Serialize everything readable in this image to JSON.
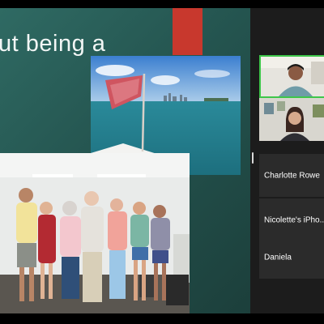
{
  "slide": {
    "title": "ut being a"
  },
  "participants": {
    "names": [
      "Charlotte Rowe",
      "Nicolette's iPho...",
      "Daniela"
    ]
  },
  "colors": {
    "slide_bg": "#2f6a63",
    "accent": "#c8382d",
    "active_speaker_border": "#3ec64a",
    "tile_bg": "#2b2b2b"
  }
}
